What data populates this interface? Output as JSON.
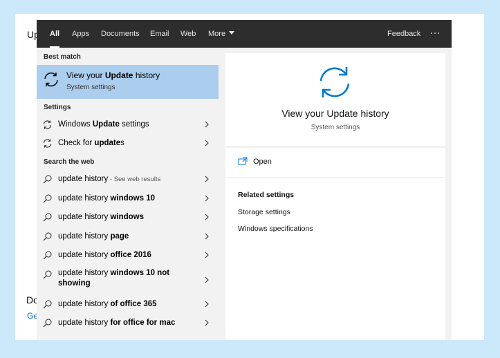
{
  "background_doc": {
    "frag_top": "Up",
    "frag_bottom": "Do",
    "frag_link": "Ge"
  },
  "tabs": [
    {
      "label": "All",
      "active": true
    },
    {
      "label": "Apps"
    },
    {
      "label": "Documents"
    },
    {
      "label": "Email"
    },
    {
      "label": "Web"
    },
    {
      "label": "More"
    }
  ],
  "feedback_label": "Feedback",
  "left": {
    "best_match_heading": "Best match",
    "best": {
      "title_pre": "View your ",
      "title_bold": "Update",
      "title_post": " history",
      "subtitle": "System settings",
      "icon": "refresh-icon"
    },
    "settings_heading": "Settings",
    "settings": [
      {
        "pre": "Windows ",
        "bold": "Update",
        "post": " settings",
        "icon": "refresh-icon"
      },
      {
        "pre": "Check for ",
        "bold": "update",
        "post": "s",
        "icon": "refresh-icon"
      }
    ],
    "web_heading": "Search the web",
    "web": [
      {
        "pre": "update history",
        "bold": "",
        "suffix": " - See web results"
      },
      {
        "pre": "update history ",
        "bold": "windows 10"
      },
      {
        "pre": "update history ",
        "bold": "windows"
      },
      {
        "pre": "update history ",
        "bold": "page"
      },
      {
        "pre": "update history ",
        "bold": "office 2016"
      },
      {
        "pre": "update history ",
        "bold": "windows 10 not showing"
      },
      {
        "pre": "update history ",
        "bold": "of office 365"
      },
      {
        "pre": "update history ",
        "bold": "for office for mac"
      }
    ]
  },
  "right": {
    "title": "View your Update history",
    "subtitle": "System settings",
    "open_label": "Open",
    "related_heading": "Related settings",
    "related": [
      "Storage settings",
      "Windows specifications"
    ]
  },
  "colors": {
    "accent": "#0078d4",
    "selected": "#abcdee",
    "topbar": "#2d2d2d",
    "page_bg": "#cce8fb"
  }
}
